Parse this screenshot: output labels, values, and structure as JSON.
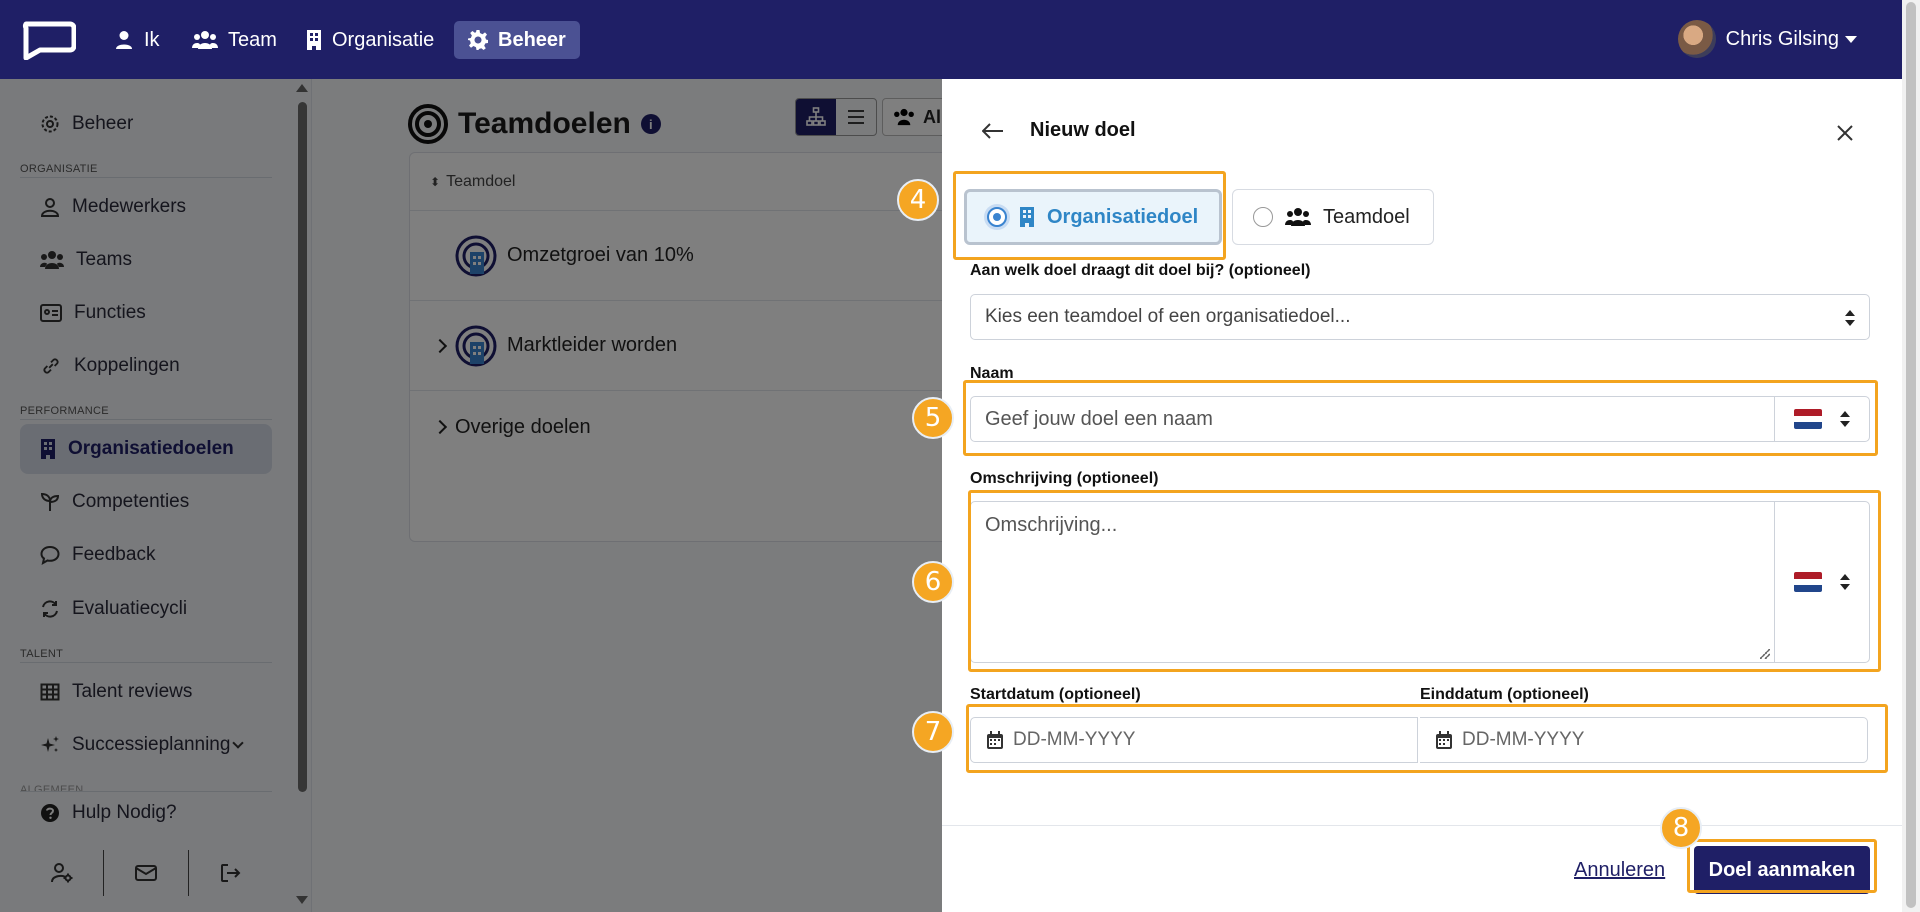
{
  "topnav": {
    "items": [
      {
        "label": "Ik",
        "icon": "user-icon"
      },
      {
        "label": "Team",
        "icon": "users-icon"
      },
      {
        "label": "Organisatie",
        "icon": "building-icon"
      },
      {
        "label": "Beheer",
        "icon": "gear-icon",
        "active": true
      }
    ],
    "user_name": "Chris Gilsing"
  },
  "sidebar": {
    "home": "Beheer",
    "sections": {
      "organisatie": "ORGANISATIE",
      "performance": "PERFORMANCE",
      "talent": "TALENT",
      "algemeen": "ALGEMEEN"
    },
    "items": {
      "medewerkers": "Medewerkers",
      "teams": "Teams",
      "functies": "Functies",
      "koppelingen": "Koppelingen",
      "organisatiedoelen": "Organisatiedoelen",
      "competenties": "Competenties",
      "feedback": "Feedback",
      "evaluatiecycli": "Evaluatiecycli",
      "talent_reviews": "Talent reviews",
      "successieplanning": "Successieplanning",
      "hulp": "Hulp Nodig?"
    }
  },
  "main": {
    "title": "Teamdoelen",
    "info": "i",
    "all_btn": "Al",
    "column_header": "Teamdoel",
    "goals": [
      {
        "label": "Omzetgroei van 10%"
      },
      {
        "label": "Marktleider worden"
      }
    ],
    "other_goals": "Overige doelen"
  },
  "panel": {
    "title": "Nieuw doel",
    "type_options": {
      "organisation": "Organisatiedoel",
      "team": "Teamdoel"
    },
    "parent_label": "Aan welk doel draagt dit doel bij? (optioneel)",
    "parent_placeholder": "Kies een teamdoel of een organisatiedoel...",
    "name_label": "Naam",
    "name_placeholder": "Geef jouw doel een naam",
    "description_label": "Omschrijving (optioneel)",
    "description_placeholder": "Omschrijving...",
    "start_label": "Startdatum (optioneel)",
    "end_label": "Einddatum (optioneel)",
    "date_placeholder": "DD-MM-YYYY",
    "cancel": "Annuleren",
    "submit": "Doel aanmaken"
  },
  "tutorial_badges": [
    "4",
    "5",
    "6",
    "7",
    "8"
  ],
  "colors": {
    "navbar": "#1f1f66",
    "accent_active": "#4b5193",
    "highlight": "#f3a41f",
    "badge": "#f5a623",
    "selected_choice_text": "#2f86c6"
  }
}
